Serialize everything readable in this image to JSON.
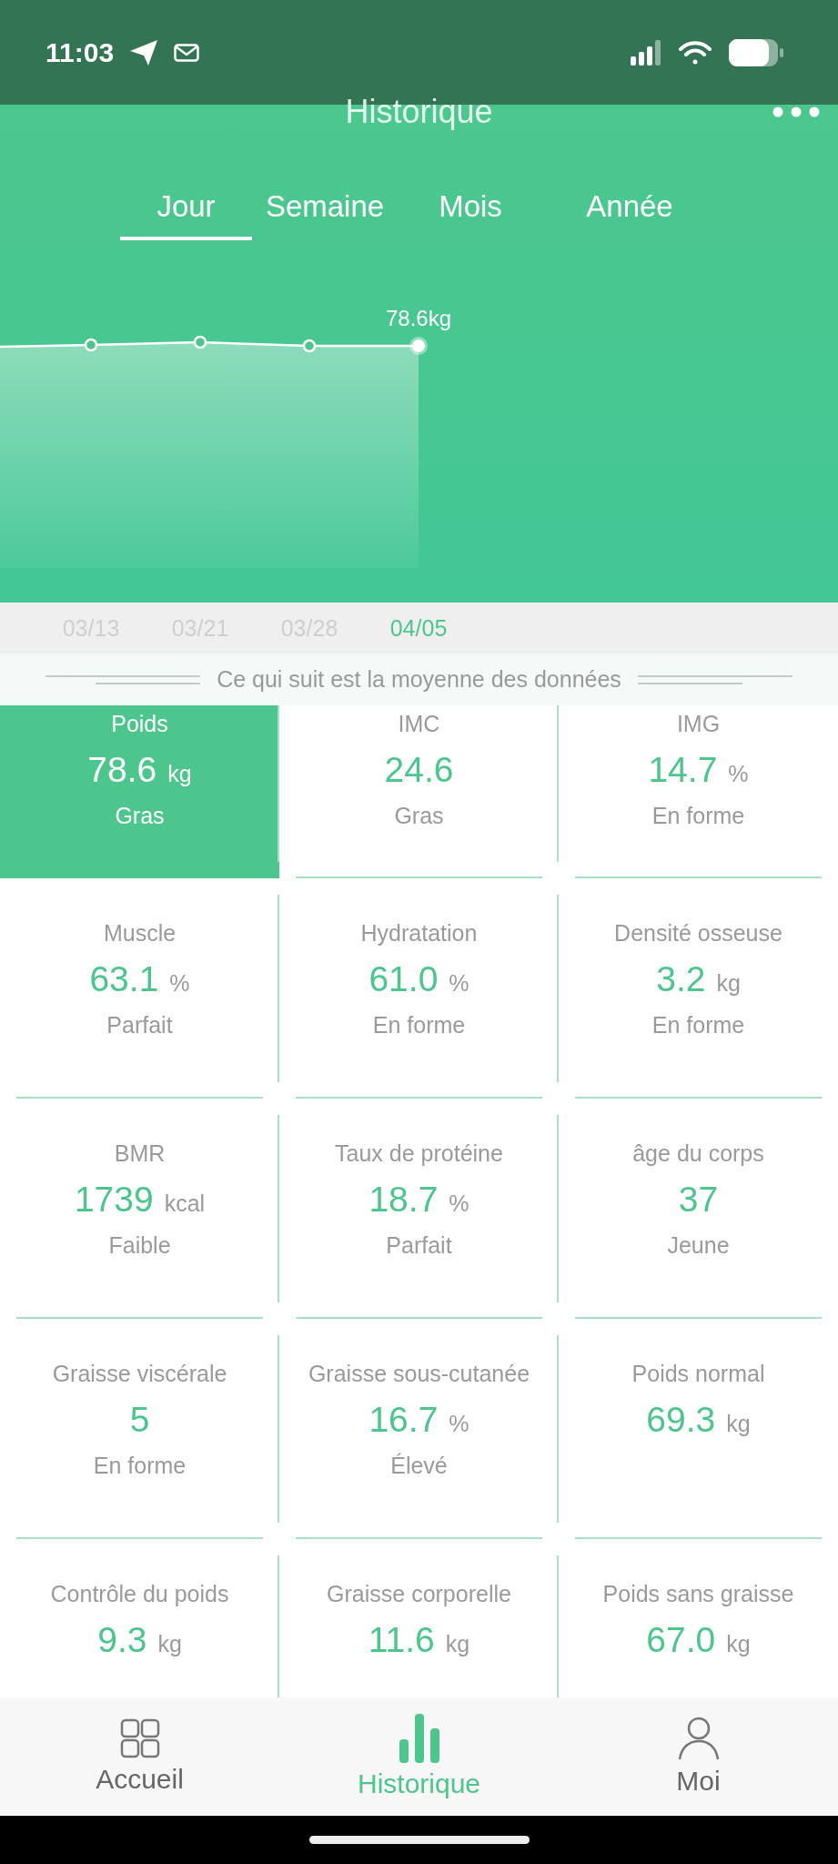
{
  "status_bar": {
    "time": "11:03"
  },
  "header": {
    "title": "Historique"
  },
  "tabs": [
    {
      "label": "Jour",
      "selected": true
    },
    {
      "label": "Semaine",
      "selected": false
    },
    {
      "label": "Mois",
      "selected": false
    },
    {
      "label": "Année",
      "selected": false
    }
  ],
  "chart": {
    "value_label": "78.6kg",
    "dates": [
      {
        "label": "03/13",
        "selected": false
      },
      {
        "label": "03/21",
        "selected": false
      },
      {
        "label": "03/28",
        "selected": false
      },
      {
        "label": "04/05",
        "selected": true
      }
    ]
  },
  "notice": "Ce qui suit est la moyenne des données",
  "metrics": [
    {
      "label": "Poids",
      "value": "78.6",
      "unit": "kg",
      "status": "Gras",
      "selected": true
    },
    {
      "label": "IMC",
      "value": "24.6",
      "status": "Gras",
      "selected": false
    },
    {
      "label": "IMG",
      "value": "14.7",
      "unit": "%",
      "status": "En forme",
      "selected": false
    },
    {
      "label": "Muscle",
      "value": "63.1",
      "unit": "%",
      "status": "Parfait",
      "selected": false
    },
    {
      "label": "Hydratation",
      "value": "61.0",
      "unit": "%",
      "status": "En forme",
      "selected": false
    },
    {
      "label": "Densité osseuse",
      "value": "3.2",
      "unit": "kg",
      "status": "En forme",
      "selected": false
    },
    {
      "label": "BMR",
      "value": "1739",
      "unit": "kcal",
      "status": "Faible",
      "selected": false
    },
    {
      "label": "Taux de protéine",
      "value": "18.7",
      "unit": "%",
      "status": "Parfait",
      "selected": false
    },
    {
      "label": "âge du corps",
      "value": "37",
      "status": "Jeune",
      "selected": false
    },
    {
      "label": "Graisse viscérale",
      "value": "5",
      "status": "En forme",
      "selected": false
    },
    {
      "label": "Graisse sous-cutanée",
      "value": "16.7",
      "unit": "%",
      "status": "Élevé",
      "selected": false
    },
    {
      "label": "Poids normal",
      "value": "69.3",
      "unit": "kg",
      "selected": false
    },
    {
      "label": "Contrôle du poids",
      "value": "9.3",
      "unit": "kg",
      "selected": false
    },
    {
      "label": "Graisse corporelle",
      "value": "11.6",
      "unit": "kg",
      "selected": false
    },
    {
      "label": "Poids sans graisse",
      "value": "67.0",
      "unit": "kg",
      "selected": false
    }
  ],
  "nav": [
    {
      "kind": "home",
      "label": "Accueil",
      "selected": false
    },
    {
      "kind": "history",
      "label": "Historique",
      "selected": true
    },
    {
      "kind": "profile",
      "label": "Moi",
      "selected": false
    }
  ]
}
